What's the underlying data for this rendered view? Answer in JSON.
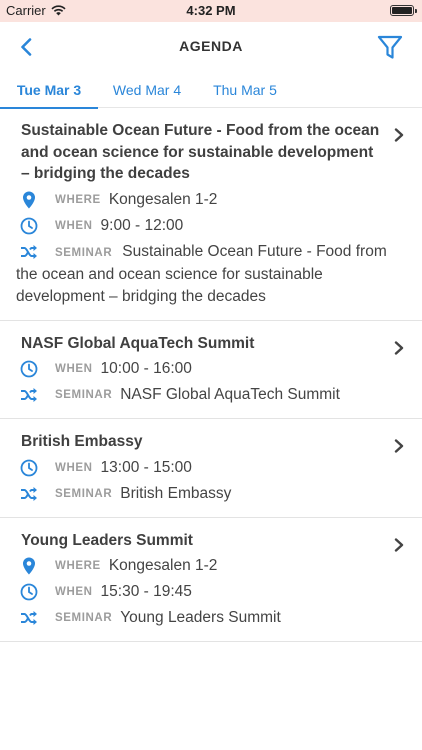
{
  "status_bar": {
    "carrier": "Carrier",
    "time": "4:32 PM"
  },
  "nav": {
    "title": "AGENDA"
  },
  "tabs": [
    {
      "label": "Tue Mar 3",
      "selected": true
    },
    {
      "label": "Wed Mar 4",
      "selected": false
    },
    {
      "label": "Thu Mar 5",
      "selected": false
    }
  ],
  "labels": {
    "where": "WHERE",
    "when": "WHEN",
    "seminar": "SEMINAR"
  },
  "events": [
    {
      "title": "Sustainable Ocean Future - Food from the ocean and ocean science for sustainable development – bridging the decades",
      "where": "Kongesalen 1-2",
      "when": "9:00 - 12:00",
      "seminar": "Sustainable Ocean Future - Food from the ocean and ocean science for sustainable development – bridging the decades"
    },
    {
      "title": "NASF Global AquaTech Summit",
      "when": "10:00 - 16:00",
      "seminar": "NASF Global AquaTech Summit"
    },
    {
      "title": "British Embassy",
      "when": "13:00 - 15:00",
      "seminar": "British Embassy"
    },
    {
      "title": "Young Leaders Summit",
      "where": "Kongesalen 1-2",
      "when": "15:30 - 19:45",
      "seminar": "Young Leaders Summit"
    }
  ],
  "colors": {
    "accent": "#2a86d9",
    "status_bar_bg": "#fbe3de",
    "label_gray": "#9c9c9c"
  },
  "icons": [
    "wifi-icon",
    "battery-icon",
    "back-chevron-icon",
    "filter-icon",
    "location-pin-icon",
    "clock-icon",
    "shuffle-icon",
    "chevron-right-icon"
  ]
}
